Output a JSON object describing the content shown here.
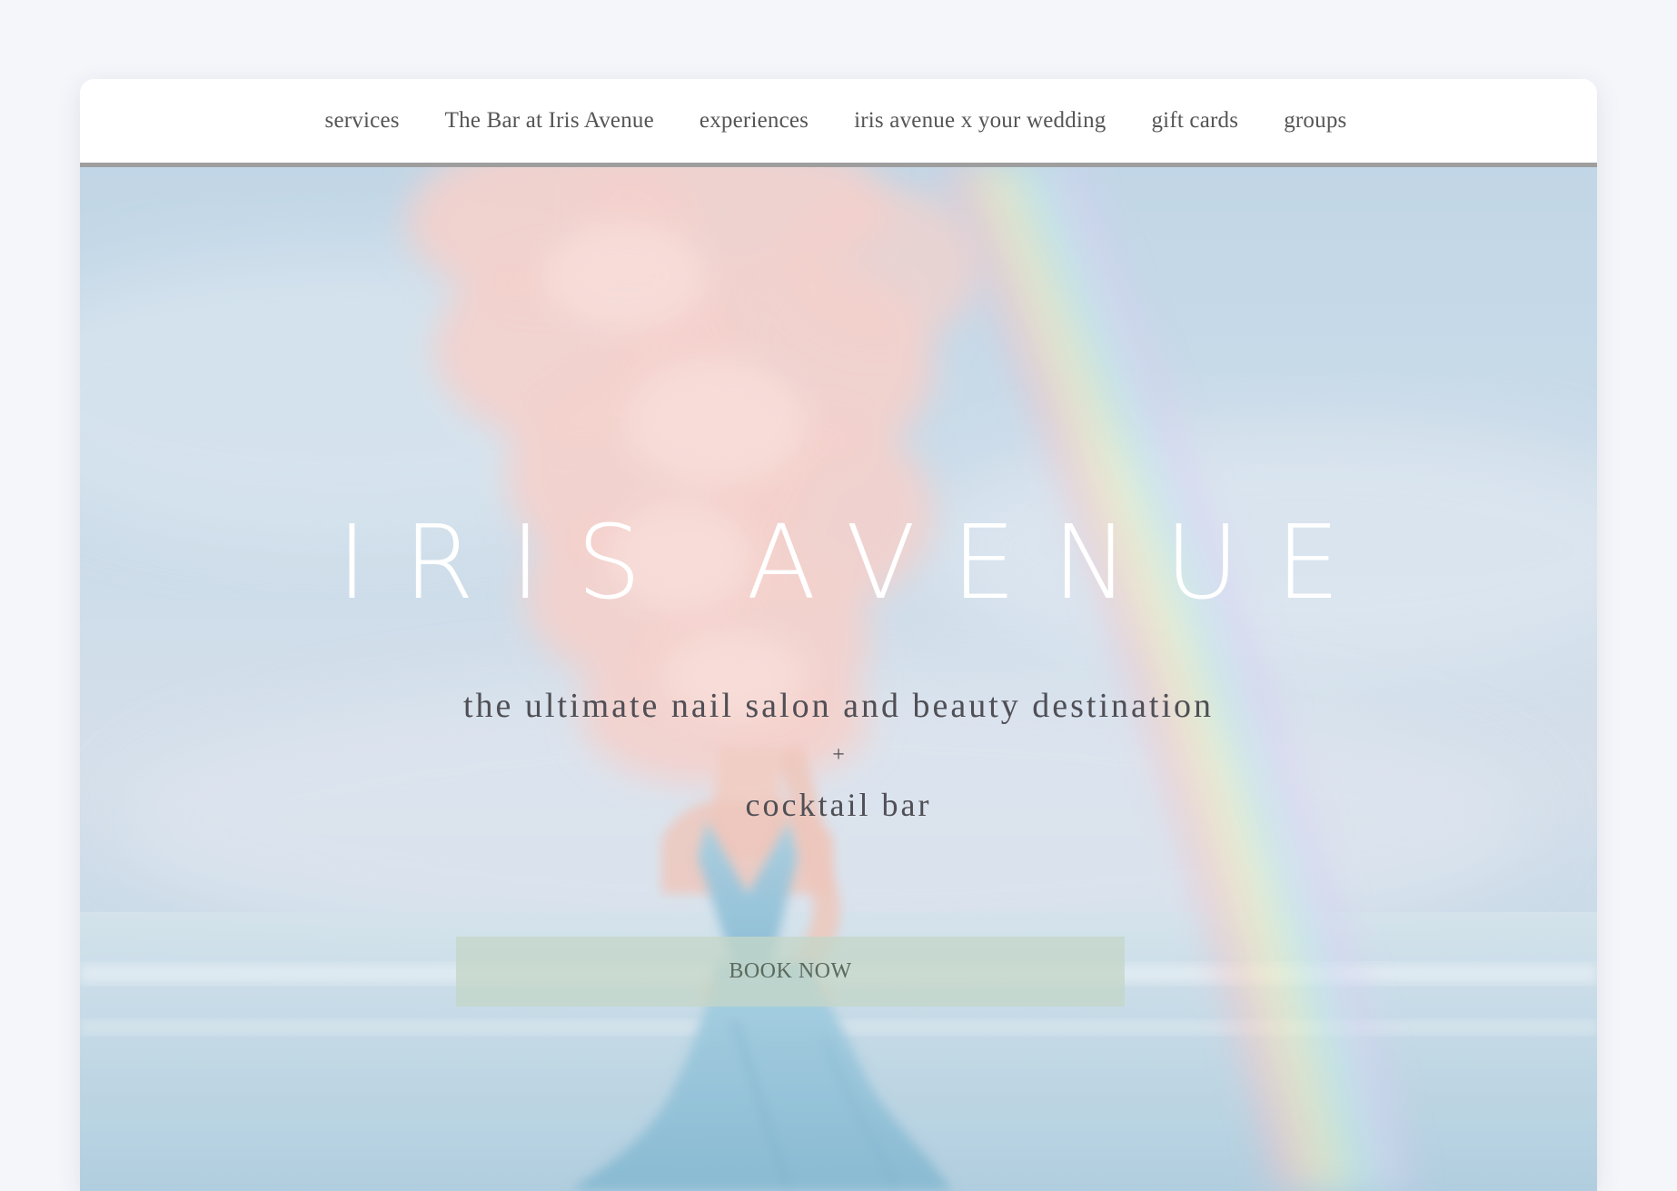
{
  "nav": {
    "items": [
      {
        "label": "services"
      },
      {
        "label": "The Bar at Iris Avenue"
      },
      {
        "label": "experiences"
      },
      {
        "label": "iris avenue x your wedding"
      },
      {
        "label": "gift cards"
      },
      {
        "label": "groups"
      }
    ]
  },
  "hero": {
    "brand": "IRIS AVENUE",
    "tagline_line1": "the ultimate nail salon and beauty destination",
    "tagline_plus": "+",
    "tagline_line2": "cocktail bar",
    "book_label": "BOOK NOW"
  },
  "colors": {
    "sky": "#c6d8e7",
    "cloud": "#f2c9c4",
    "dress": "#8fc0d8",
    "book_bg": "#c4d6c8",
    "nav_text": "#555555",
    "tagline_text": "#4f4f55",
    "brand_text": "#ffffff"
  }
}
